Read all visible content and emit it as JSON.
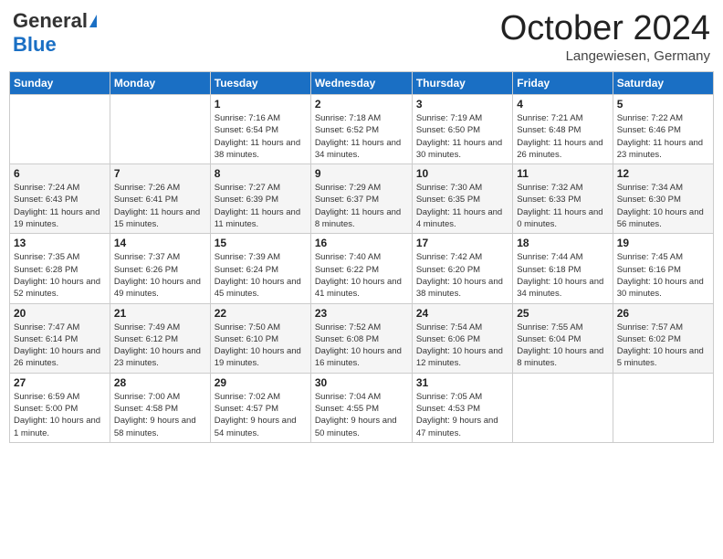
{
  "header": {
    "logo_general": "General",
    "logo_blue": "Blue",
    "title": "October 2024",
    "location": "Langewiesen, Germany"
  },
  "days_of_week": [
    "Sunday",
    "Monday",
    "Tuesday",
    "Wednesday",
    "Thursday",
    "Friday",
    "Saturday"
  ],
  "weeks": [
    [
      {
        "day": "",
        "info": ""
      },
      {
        "day": "",
        "info": ""
      },
      {
        "day": "1",
        "info": "Sunrise: 7:16 AM\nSunset: 6:54 PM\nDaylight: 11 hours and 38 minutes."
      },
      {
        "day": "2",
        "info": "Sunrise: 7:18 AM\nSunset: 6:52 PM\nDaylight: 11 hours and 34 minutes."
      },
      {
        "day": "3",
        "info": "Sunrise: 7:19 AM\nSunset: 6:50 PM\nDaylight: 11 hours and 30 minutes."
      },
      {
        "day": "4",
        "info": "Sunrise: 7:21 AM\nSunset: 6:48 PM\nDaylight: 11 hours and 26 minutes."
      },
      {
        "day": "5",
        "info": "Sunrise: 7:22 AM\nSunset: 6:46 PM\nDaylight: 11 hours and 23 minutes."
      }
    ],
    [
      {
        "day": "6",
        "info": "Sunrise: 7:24 AM\nSunset: 6:43 PM\nDaylight: 11 hours and 19 minutes."
      },
      {
        "day": "7",
        "info": "Sunrise: 7:26 AM\nSunset: 6:41 PM\nDaylight: 11 hours and 15 minutes."
      },
      {
        "day": "8",
        "info": "Sunrise: 7:27 AM\nSunset: 6:39 PM\nDaylight: 11 hours and 11 minutes."
      },
      {
        "day": "9",
        "info": "Sunrise: 7:29 AM\nSunset: 6:37 PM\nDaylight: 11 hours and 8 minutes."
      },
      {
        "day": "10",
        "info": "Sunrise: 7:30 AM\nSunset: 6:35 PM\nDaylight: 11 hours and 4 minutes."
      },
      {
        "day": "11",
        "info": "Sunrise: 7:32 AM\nSunset: 6:33 PM\nDaylight: 11 hours and 0 minutes."
      },
      {
        "day": "12",
        "info": "Sunrise: 7:34 AM\nSunset: 6:30 PM\nDaylight: 10 hours and 56 minutes."
      }
    ],
    [
      {
        "day": "13",
        "info": "Sunrise: 7:35 AM\nSunset: 6:28 PM\nDaylight: 10 hours and 52 minutes."
      },
      {
        "day": "14",
        "info": "Sunrise: 7:37 AM\nSunset: 6:26 PM\nDaylight: 10 hours and 49 minutes."
      },
      {
        "day": "15",
        "info": "Sunrise: 7:39 AM\nSunset: 6:24 PM\nDaylight: 10 hours and 45 minutes."
      },
      {
        "day": "16",
        "info": "Sunrise: 7:40 AM\nSunset: 6:22 PM\nDaylight: 10 hours and 41 minutes."
      },
      {
        "day": "17",
        "info": "Sunrise: 7:42 AM\nSunset: 6:20 PM\nDaylight: 10 hours and 38 minutes."
      },
      {
        "day": "18",
        "info": "Sunrise: 7:44 AM\nSunset: 6:18 PM\nDaylight: 10 hours and 34 minutes."
      },
      {
        "day": "19",
        "info": "Sunrise: 7:45 AM\nSunset: 6:16 PM\nDaylight: 10 hours and 30 minutes."
      }
    ],
    [
      {
        "day": "20",
        "info": "Sunrise: 7:47 AM\nSunset: 6:14 PM\nDaylight: 10 hours and 26 minutes."
      },
      {
        "day": "21",
        "info": "Sunrise: 7:49 AM\nSunset: 6:12 PM\nDaylight: 10 hours and 23 minutes."
      },
      {
        "day": "22",
        "info": "Sunrise: 7:50 AM\nSunset: 6:10 PM\nDaylight: 10 hours and 19 minutes."
      },
      {
        "day": "23",
        "info": "Sunrise: 7:52 AM\nSunset: 6:08 PM\nDaylight: 10 hours and 16 minutes."
      },
      {
        "day": "24",
        "info": "Sunrise: 7:54 AM\nSunset: 6:06 PM\nDaylight: 10 hours and 12 minutes."
      },
      {
        "day": "25",
        "info": "Sunrise: 7:55 AM\nSunset: 6:04 PM\nDaylight: 10 hours and 8 minutes."
      },
      {
        "day": "26",
        "info": "Sunrise: 7:57 AM\nSunset: 6:02 PM\nDaylight: 10 hours and 5 minutes."
      }
    ],
    [
      {
        "day": "27",
        "info": "Sunrise: 6:59 AM\nSunset: 5:00 PM\nDaylight: 10 hours and 1 minute."
      },
      {
        "day": "28",
        "info": "Sunrise: 7:00 AM\nSunset: 4:58 PM\nDaylight: 9 hours and 58 minutes."
      },
      {
        "day": "29",
        "info": "Sunrise: 7:02 AM\nSunset: 4:57 PM\nDaylight: 9 hours and 54 minutes."
      },
      {
        "day": "30",
        "info": "Sunrise: 7:04 AM\nSunset: 4:55 PM\nDaylight: 9 hours and 50 minutes."
      },
      {
        "day": "31",
        "info": "Sunrise: 7:05 AM\nSunset: 4:53 PM\nDaylight: 9 hours and 47 minutes."
      },
      {
        "day": "",
        "info": ""
      },
      {
        "day": "",
        "info": ""
      }
    ]
  ]
}
